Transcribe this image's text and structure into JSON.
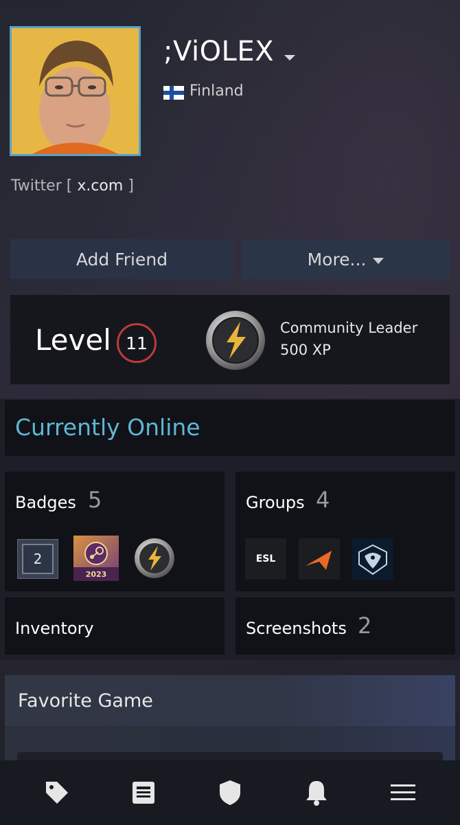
{
  "profile": {
    "name": ";ViOLEX",
    "country": "Finland",
    "flag_icon": "finland-flag-icon",
    "link_prefix": "Twitter [",
    "link_text": "x.com",
    "link_suffix": "]"
  },
  "actions": {
    "add_friend": "Add Friend",
    "more": "More..."
  },
  "level": {
    "label": "Level",
    "value": "11",
    "badge_title": "Community Leader",
    "badge_xp": "500 XP"
  },
  "status": {
    "text": "Currently Online",
    "color": "#5fb7d4"
  },
  "tiles": {
    "badges": {
      "title": "Badges",
      "count": "5",
      "items": [
        "2",
        "2023",
        "community-leader-badge-icon"
      ]
    },
    "groups": {
      "title": "Groups",
      "count": "4",
      "items": [
        "ESL",
        "orange-chevron-logo",
        "team-liquid-logo"
      ]
    },
    "inventory": {
      "title": "Inventory"
    },
    "screenshots": {
      "title": "Screenshots",
      "count": "2"
    }
  },
  "favorite_game": {
    "title": "Favorite Game"
  },
  "bottom_nav": [
    "tag-icon",
    "news-icon",
    "shield-icon",
    "bell-icon",
    "menu-icon"
  ],
  "colors": {
    "accent_online": "#5fb7d4",
    "level_ring": "#c0393d",
    "avatar_border": "#5aa3c6"
  }
}
